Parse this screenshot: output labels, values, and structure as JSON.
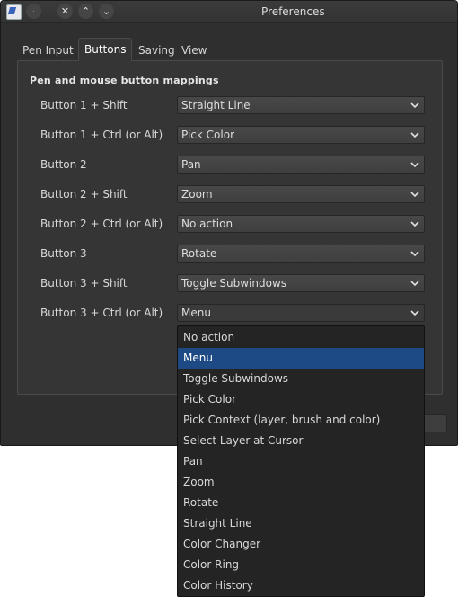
{
  "window": {
    "title": "Preferences"
  },
  "titlebar": {
    "close_glyph": "✕",
    "maximize_glyph": "⌃",
    "minimize_glyph": "⌄",
    "menu_glyph": "·"
  },
  "tabs": [
    {
      "label": "Pen Input",
      "active": false
    },
    {
      "label": "Buttons",
      "active": true
    },
    {
      "label": "Saving",
      "active": false
    },
    {
      "label": "View",
      "active": false
    }
  ],
  "section": {
    "title": "Pen and mouse button mappings"
  },
  "mappings": [
    {
      "label": "Button 1 + Shift",
      "value": "Straight Line"
    },
    {
      "label": "Button 1 + Ctrl (or Alt)",
      "value": "Pick Color"
    },
    {
      "label": "Button 2",
      "value": "Pan"
    },
    {
      "label": "Button 2 + Shift",
      "value": "Zoom"
    },
    {
      "label": "Button 2 + Ctrl (or Alt)",
      "value": "No action"
    },
    {
      "label": "Button 3",
      "value": "Rotate"
    },
    {
      "label": "Button 3 + Shift",
      "value": "Toggle Subwindows"
    },
    {
      "label": "Button 3 + Ctrl (or Alt)",
      "value": "Menu"
    }
  ],
  "dropdown": {
    "selected_index": 1,
    "options": [
      "No action",
      "Menu",
      "Toggle Subwindows",
      "Pick Color",
      "Pick Context (layer, brush and color)",
      "Select Layer at Cursor",
      "Pan",
      "Zoom",
      "Rotate",
      "Straight Line",
      "Color Changer",
      "Color Ring",
      "Color History"
    ]
  },
  "colors": {
    "window_bg": "#2f2f2f",
    "panel_bg": "#353535",
    "selection": "#1d4a84",
    "text": "#d8d8d8"
  }
}
